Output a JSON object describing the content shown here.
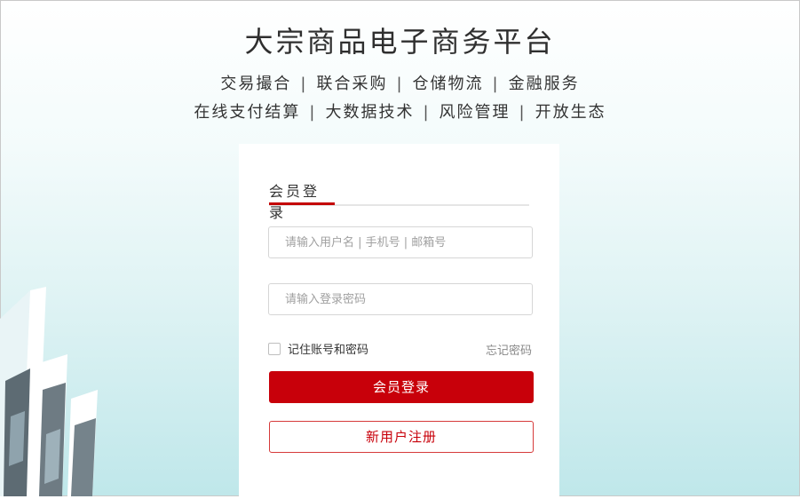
{
  "header": {
    "title": "大宗商品电子商务平台",
    "line1": [
      "交易撮合",
      "联合采购",
      "仓储物流",
      "金融服务"
    ],
    "line2": [
      "在线支付结算",
      "大数据技术",
      "风险管理",
      "开放生态"
    ],
    "separator": "|"
  },
  "login": {
    "tab_label": "会员登录",
    "username_placeholder": "请输入用户名 | 手机号 | 邮箱号",
    "password_placeholder": "请输入登录密码",
    "remember_label": "记住账号和密码",
    "forgot_label": "忘记密码",
    "login_button": "会员登录",
    "register_button": "新用户注册"
  },
  "colors": {
    "brand_red": "#c8000a",
    "background_teal": "#bfe7ea"
  }
}
